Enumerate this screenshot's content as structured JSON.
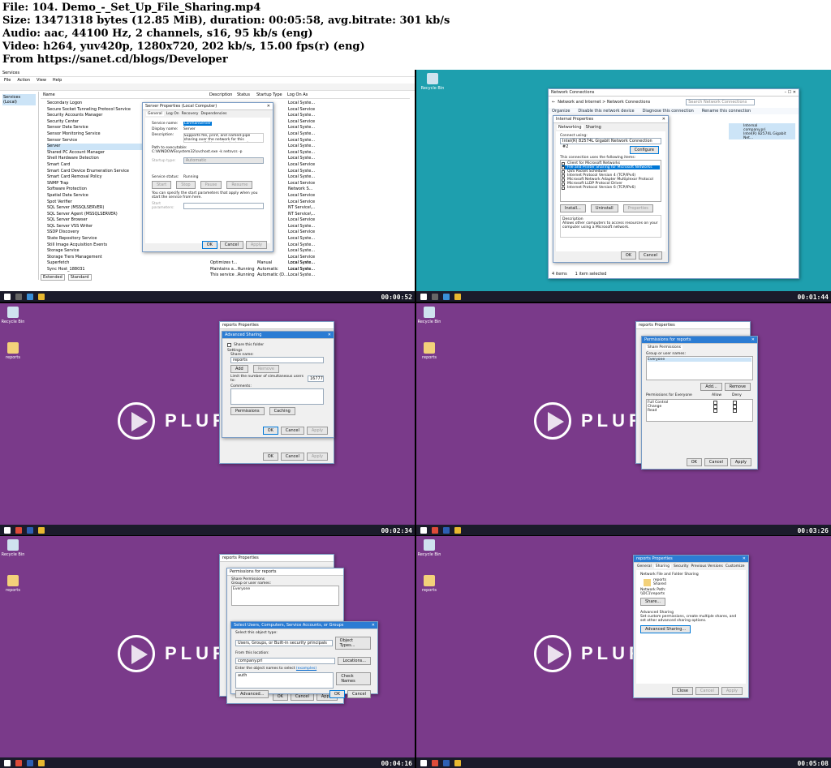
{
  "header": {
    "file_line": "File: 104. Demo_-_Set_Up_File_Sharing.mp4",
    "size_line": "Size: 13471318 bytes (12.85 MiB), duration: 00:05:58, avg.bitrate: 301 kb/s",
    "audio_line": "Audio: aac, 44100 Hz, 2 channels, s16, 95 kb/s (eng)",
    "video_line": "Video: h264, yuv420p, 1280x720, 202 kb/s, 15.00 fps(r) (eng)",
    "from_line": "From https://sanet.cd/blogs/Developer"
  },
  "colors": {
    "purple_bg": "#7a3a8a",
    "teal_bg": "#1e9fae",
    "titlebar_active": "#2b7cd3"
  },
  "logo_text": "PLURA",
  "recycle_bin": "Recycle Bin",
  "reports_icon": "reports",
  "frames": {
    "f1": {
      "timestamp": "00:00:52",
      "services_title": "Services",
      "menu": [
        "File",
        "Action",
        "View",
        "Help"
      ],
      "tree_item": "Services (Local)",
      "columns": [
        "Name",
        "Description",
        "Status",
        "Startup Type",
        "Log On As"
      ],
      "services": [
        "Secondary Logon",
        "Secure Socket Tunneling Protocol Service",
        "Security Accounts Manager",
        "Security Center",
        "Sensor Data Service",
        "Sensor Monitoring Service",
        "Sensor Service",
        "Server",
        "Shared PC Account Manager",
        "Shell Hardware Detection",
        "Smart Card",
        "Smart Card Device Enumeration Service",
        "Smart Card Removal Policy",
        "SNMP Trap",
        "Software Protection",
        "Spatial Data Service",
        "Spot Verifier",
        "SQL Server (MSSQLSERVER)",
        "SQL Server Agent (MSSQLSERVER)",
        "SQL Server Browser",
        "SQL Server VSS Writer",
        "SSDP Discovery",
        "State Repository Service",
        "Still Image Acquisition Events",
        "Storage Service",
        "Storage Tiers Management",
        "Superfetch",
        "Sync Host_188031"
      ],
      "logon": [
        "Local Syste...",
        "Local Service",
        "Local Syste...",
        "Local Service",
        "Local Syste...",
        "Local Syste...",
        "Local Syste...",
        "Local Syste...",
        "Local Syste...",
        "Local Syste...",
        "Local Service",
        "Local Syste...",
        "Local Syste...",
        "Local Service",
        "Network S...",
        "Local Service",
        "Local Service",
        "NT Service\\...",
        "NT Service\\...",
        "Local Service",
        "Local Syste...",
        "Local Service",
        "Local Syste...",
        "Local Syste...",
        "Local Syste...",
        "Local Service",
        "Local Syste...",
        "Local Syste..."
      ],
      "tail_rows": [
        [
          "Optimizes t...",
          "",
          "Manual",
          "Local Syste..."
        ],
        [
          "Maintains a...",
          "Running",
          "Automatic",
          "Local Syste..."
        ],
        [
          "This service ...",
          "Running",
          "Automatic (D...",
          "Local Syste..."
        ]
      ],
      "bottom_tabs": [
        "Extended",
        "Standard"
      ],
      "dialog": {
        "title": "Server Properties (Local Computer)",
        "tabs": [
          "General",
          "Log On",
          "Recovery",
          "Dependencies"
        ],
        "service_name_label": "Service name:",
        "service_name": "LanmanServer",
        "display_name_label": "Display name:",
        "display_name": "Server",
        "description_label": "Description:",
        "description": "Supports file, print, and named-pipe sharing over the network for this computer. If this service is stopped,",
        "path_label": "Path to executable:",
        "path": "C:\\WINDOWS\\system32\\svchost.exe -k netsvcs -p",
        "startup_label": "Startup type:",
        "startup_value": "Automatic",
        "status_label": "Service status:",
        "status_value": "Running",
        "control_buttons": [
          "Start",
          "Stop",
          "Pause",
          "Resume"
        ],
        "hint": "You can specify the start parameters that apply when you start the service from here.",
        "params_label": "Start parameters:",
        "ok": "OK",
        "cancel": "Cancel",
        "apply": "Apply"
      }
    },
    "f2": {
      "timestamp": "00:01:44",
      "nc_title": "Network Connections",
      "breadcrumb": "Network and Internet  >  Network Connections",
      "search_placeholder": "Search Network Connections",
      "toolbar": [
        "Organize",
        "Disable this network device",
        "Diagnose this connection",
        "Rename this connection"
      ],
      "adapter_name": "Internal",
      "adapter_sub": "company.pri",
      "adapter_hw": "Intel(R) 82574L Gigabit Net...",
      "status_bar": [
        "4 items",
        "1 item selected"
      ],
      "dialog": {
        "title": "Internal Properties",
        "tabs": [
          "Networking",
          "Sharing"
        ],
        "connect_using": "Connect using:",
        "adapter": "Intel(R) 82574L Gigabit Network Connection #2",
        "configure": "Configure",
        "items_label": "This connection uses the following items:",
        "items": [
          "Client for Microsoft Networks",
          "File and Printer Sharing for Microsoft Networks",
          "QoS Packet Scheduler",
          "Internet Protocol Version 4 (TCP/IPv4)",
          "Microsoft Network Adapter Multiplexor Protocol",
          "Microsoft LLDP Protocol Driver",
          "Internet Protocol Version 6 (TCP/IPv6)"
        ],
        "install": "Install...",
        "uninstall": "Uninstall",
        "properties": "Properties",
        "desc_label": "Description",
        "desc": "Allows other computers to access resources on your computer using a Microsoft network.",
        "ok": "OK",
        "cancel": "Cancel"
      }
    },
    "f3": {
      "timestamp": "00:02:34",
      "back_title": "reports Properties",
      "title": "Advanced Sharing",
      "share_check": "Share this folder",
      "settings": "Settings",
      "share_name_label": "Share name:",
      "share_name": "reports",
      "add": "Add",
      "remove": "Remove",
      "limit_label": "Limit the number of simultaneous users to:",
      "limit_value": "16777",
      "comments_label": "Comments:",
      "permissions": "Permissions",
      "caching": "Caching",
      "ok": "OK",
      "cancel": "Cancel",
      "apply": "Apply"
    },
    "f4": {
      "timestamp": "00:03:26",
      "back_title": "reports Properties",
      "title": "Permissions for reports",
      "tab": "Share Permissions",
      "group_label": "Group or user names:",
      "group_item": "Everyone",
      "add": "Add...",
      "remove": "Remove",
      "perm_label": "Permissions for Everyone",
      "allow": "Allow",
      "deny": "Deny",
      "perms": [
        "Full Control",
        "Change",
        "Read"
      ],
      "ok": "OK",
      "cancel": "Cancel",
      "apply": "Apply"
    },
    "f5": {
      "timestamp": "00:04:16",
      "back_title": "reports Properties",
      "perm_title": "Permissions for reports",
      "perm_tab": "Share Permissions",
      "group_label": "Group or user names:",
      "group_item": "Everyone",
      "title": "Select Users, Computers, Service Accounts, or Groups",
      "obj_type_label": "Select this object type:",
      "obj_type": "Users, Groups, or Built-in security principals",
      "obj_types_btn": "Object Types...",
      "location_label": "From this location:",
      "location": "company.pri",
      "locations_btn": "Locations...",
      "names_label": "Enter the object names to select",
      "names_link": "(examples)",
      "names_value": "auth",
      "check_names": "Check Names",
      "advanced": "Advanced...",
      "ok": "OK",
      "cancel": "Cancel",
      "apply": "Apply"
    },
    "f6": {
      "timestamp": "00:05:08",
      "title": "reports Properties",
      "tabs": [
        "General",
        "Sharing",
        "Security",
        "Previous Versions",
        "Customize"
      ],
      "nffs": "Network File and Folder Sharing",
      "folder": "reports",
      "folder_state": "Shared",
      "path_label": "Network Path:",
      "path": "\\\\DC1\\reports",
      "share_btn": "Share...",
      "adv_label": "Advanced Sharing",
      "adv_desc": "Set custom permissions, create multiple shares, and set other advanced sharing options.",
      "adv_btn": "Advanced Sharing...",
      "close": "Close",
      "cancel": "Cancel",
      "apply": "Apply"
    }
  }
}
